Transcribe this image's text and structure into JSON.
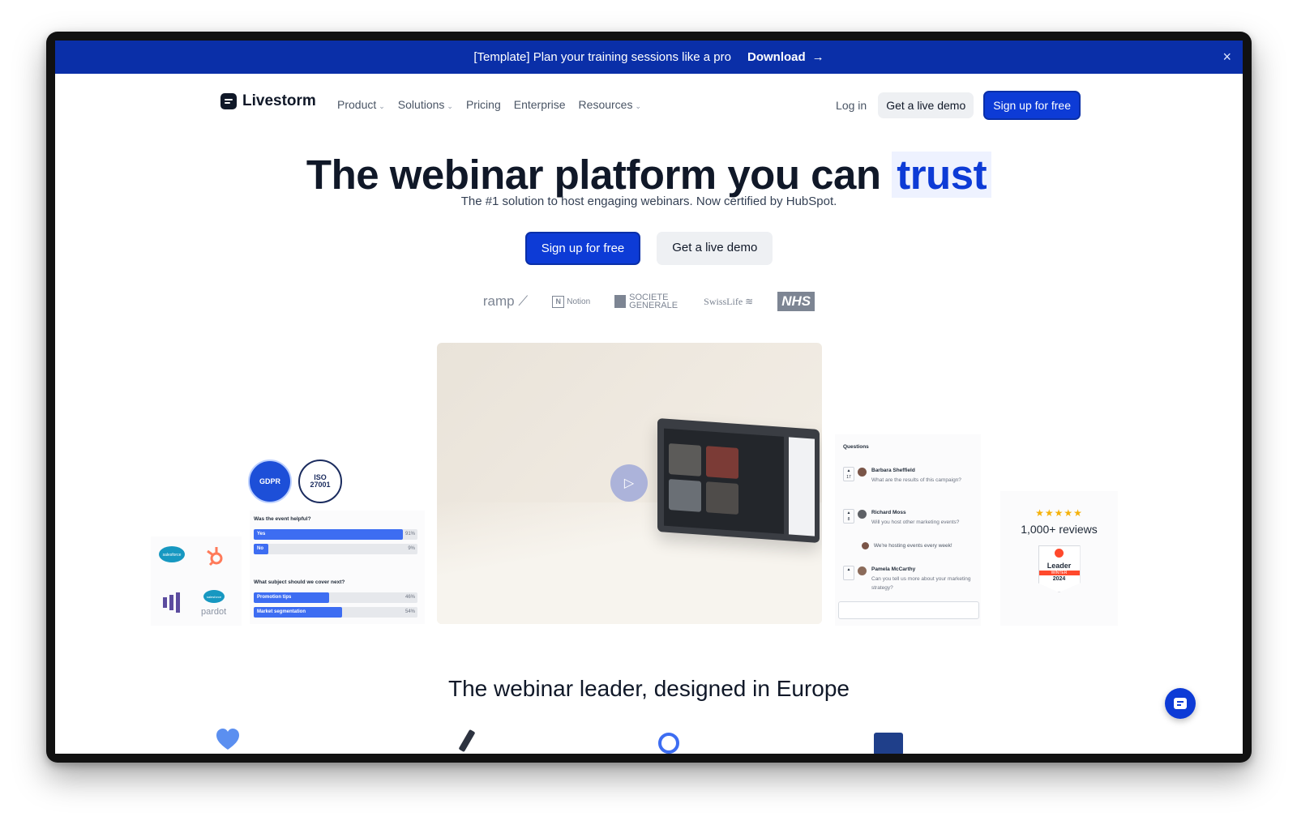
{
  "announcement": {
    "text": "[Template] Plan your training sessions like a pro",
    "link_label": "Download",
    "link_arrow": "→",
    "close_icon": "×"
  },
  "nav": {
    "brand": "Livestorm",
    "items": [
      {
        "label": "Product",
        "has_dropdown": true
      },
      {
        "label": "Solutions",
        "has_dropdown": true
      },
      {
        "label": "Pricing",
        "has_dropdown": false
      },
      {
        "label": "Enterprise",
        "has_dropdown": false
      },
      {
        "label": "Resources",
        "has_dropdown": true
      }
    ],
    "login": "Log in",
    "demo": "Get a live demo",
    "signup": "Sign up for free"
  },
  "hero": {
    "title_main": "The webinar platform you can",
    "title_accent": "trust",
    "subtitle": "The #1 solution to host engaging webinars. Now certified by HubSpot.",
    "cta_primary": "Sign up for free",
    "cta_secondary": "Get a live demo"
  },
  "customer_logos": [
    "ramp",
    "Notion",
    "SOCIETE GENERALE",
    "SwissLife",
    "NHS"
  ],
  "certifications": [
    {
      "label": "GDPR"
    },
    {
      "label": "ISO 27001"
    }
  ],
  "integrations": [
    "salesforce",
    "hubspot",
    "marketo",
    "pardot"
  ],
  "poll": {
    "q1": "Was the event helpful?",
    "q1_options": [
      {
        "label": "Yes",
        "percent": 91,
        "pct_text": "91%"
      },
      {
        "label": "No",
        "percent": 9,
        "pct_text": "9%"
      }
    ],
    "q2": "What subject should we cover next?",
    "q2_options": [
      {
        "label": "Promotion tips",
        "percent": 46,
        "pct_text": "46%"
      },
      {
        "label": "Market segmentation",
        "percent": 54,
        "pct_text": "54%"
      }
    ]
  },
  "questions": {
    "header": "Questions",
    "items": [
      {
        "name": "Barbara Sheffield",
        "text": "What are the results of this campaign?",
        "votes": "17"
      },
      {
        "name": "Richard Moss",
        "text": "Will you host other marketing events?",
        "votes": "8"
      },
      {
        "name": "Pamela McCarthy",
        "text": "Can you tell us more about your marketing strategy?",
        "votes": ""
      }
    ],
    "reply": "We're hosting events every week!"
  },
  "reviews": {
    "stars": "★★★★★",
    "count": "1,000+ reviews",
    "badge_title": "Leader",
    "badge_season": "WINTER",
    "badge_year": "2024"
  },
  "section": {
    "title": "The webinar leader, designed in Europe"
  },
  "colors": {
    "brand_blue": "#0d3bd6",
    "announcement_bg": "#0a2fa8",
    "text_dark": "#101828"
  }
}
